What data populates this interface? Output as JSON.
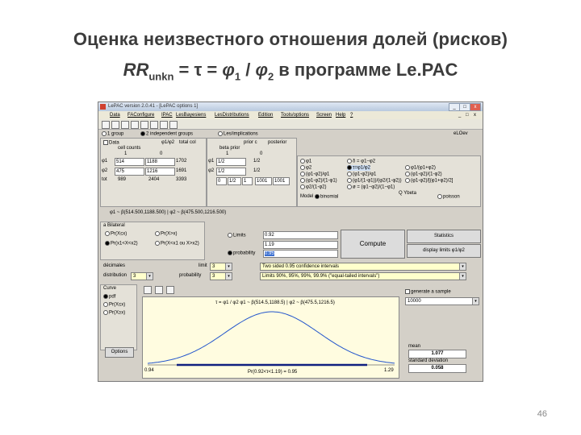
{
  "slide": {
    "title": "Оценка неизвестного отношения долей (рисков)",
    "formula_rr": "RR",
    "formula_sub": "unkn",
    "formula_mid": " = τ = ",
    "formula_phi1": "φ",
    "formula_phi1_sub": "1",
    "formula_slash": " / ",
    "formula_phi2": "φ",
    "formula_phi2_sub": "2",
    "formula_tail": " в программе Le.PAC",
    "page_number": "46"
  },
  "window": {
    "title": "LePAC version 2.0.41 - [LePAC options 1]",
    "buttons": {
      "minimize": "_",
      "maximize": "□",
      "close": "x"
    },
    "menu": [
      "Data",
      "FAConfigure",
      "IPAC",
      "LesBayesiens",
      "LesDistributions",
      "Edition",
      "Tools/options",
      "Screen",
      "Help",
      "?"
    ],
    "subwindow_buttons": {
      "minimize": "_",
      "restore": "□",
      "close": "x"
    }
  },
  "design": {
    "option1": "1 group",
    "option2": "2 independent groups",
    "option3": "Les/implications",
    "right_tag": "eLOev"
  },
  "data_panel": {
    "data_check": "Data",
    "col1_header": "φ1/φ2",
    "col2_header": "total col",
    "cell_counts_label": "cell counts",
    "count_hdr1": "1",
    "count_hdr2": "0",
    "row1_label": "φ1",
    "row1_v1": "514",
    "row1_v2": "1188",
    "row1_v3": "1702",
    "row2_label": "φ2",
    "row2_v1": "475",
    "row2_v2": "1216",
    "row2_v3": "1691",
    "total_label": "tot",
    "total_v1": "989",
    "total_v2": "2404",
    "total_v3": "3393"
  },
  "prior_panel": {
    "header1": "prior c",
    "header2": "posterior",
    "sub_label": "beta prior",
    "hdr1": "1",
    "hdr2": "0",
    "row1_label": "φ1",
    "row1_v1": "1/2",
    "row1_v2": "1/2",
    "row2_label": "φ2",
    "row2_v1": "1/2",
    "row2_v2": "1/2",
    "row3_v1": "0",
    "row3_v2": "1/2",
    "row3_v3": "1",
    "row3_v4": "1001",
    "row3_v5": "1001"
  },
  "parameters": {
    "left": [
      "φ1",
      "φ2",
      "(φ1-φ2)/φ1",
      "(φ1-φ2)/(1-φ1)",
      "φ2/(1-φ2)"
    ],
    "mid": [
      "δ = φ1−φ2",
      "τ=φ1/φ2",
      "(φ1-φ2)/φ1",
      "(φ1/(1-φ1))/(φ2/(1-φ2))",
      "ø = (φ1−φ2)/(1−φ1)"
    ],
    "right": [
      "φ1/(φ1+φ2)",
      "(φ1-φ2)/(1-φ2)",
      "(φ1-φ2)/[(φ1+φ2)/2]"
    ],
    "selected": "τ=φ1/φ2",
    "model_label": "Model",
    "model_value": "binomial",
    "poisson": "poisson",
    "pbeta": "Q Ybeta"
  },
  "posterior_text": "φ1 ~ β(514.500,1188.500) | φ2 ~ β(475.500,1216.500)",
  "interval": {
    "group_label": "a Bilateral",
    "options": [
      "Pr(X≤x)",
      "Pr(X>x)",
      "Pr(x1<X<x2)",
      "Pr(X<x1 ou X>x2)"
    ],
    "limits_label": "Limits",
    "limit1": "0.92",
    "limit2": "1.19",
    "probability_label": "probability",
    "probability_value": "0.95",
    "compute_label": "Compute",
    "statistics_label": "Statistics",
    "display_limits_label": "display limits φ1/φ2"
  },
  "settings": {
    "decimales_label": "décimales",
    "decimales_value": "3",
    "limit_label": "limit",
    "limit_value": "3",
    "distribution_label": "distribution",
    "distribution_value": "3",
    "probability_label": "probability",
    "probability_value": "3",
    "select1": "Two sided 0.95 confidence intervals",
    "select2": "Limits 90%, 95%, 99%, 99.9% (\"equal-tailed intervals\")"
  },
  "curve": {
    "group_label": "Curve",
    "options": [
      "pdf",
      "Pr(X≤x)",
      "Pr(X≥x)"
    ],
    "selected": "pdf",
    "options_button": "Options",
    "plot_title": "τ = φ1 / φ2   φ1 ~ β(514.5,1188.5) | φ2 ~ β(475.5,1216.5)",
    "x_left": "0.94",
    "x_right": "1.29",
    "lower_caption": "Pr(0.92<τ<1.19) = 0.95"
  },
  "sample": {
    "generate_label": "generate a sample",
    "sample_size": "10000",
    "mean_label": "mean",
    "mean_value": "1.077",
    "sd_label": "standard deviation",
    "sd_value": "0.058"
  }
}
